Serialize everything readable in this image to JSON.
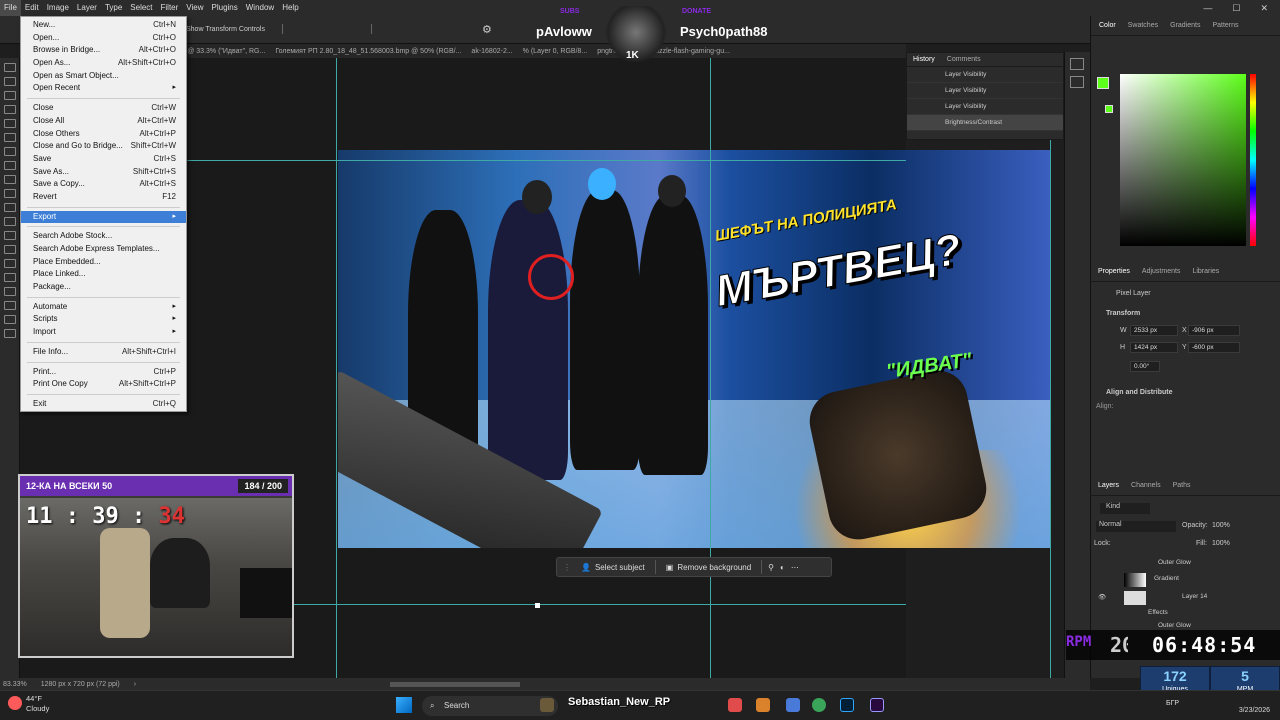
{
  "menubar": {
    "items": [
      "File",
      "Edit",
      "Image",
      "Layer",
      "Type",
      "Select",
      "Filter",
      "View",
      "Plugins",
      "Window",
      "Help"
    ],
    "active": "File"
  },
  "optbar": {
    "show_transform": "Show Transform Controls"
  },
  "tabs": [
    "легенда .psb @ 33.3% (\"Идват\", RG...",
    "Големият РП 2.80_18_48_51.568003.bmp @ 50% (RGB/...",
    "ak-16802-2...",
    "% (Layer 0, RGB/8...",
    "pngtree-realistic-muzzle-flash-gaming-gu..."
  ],
  "file_menu": {
    "groups": [
      [
        {
          "label": "New...",
          "shortcut": "Ctrl+N"
        },
        {
          "label": "Open...",
          "shortcut": "Ctrl+O"
        },
        {
          "label": "Browse in Bridge...",
          "shortcut": "Alt+Ctrl+O"
        },
        {
          "label": "Open As...",
          "shortcut": "Alt+Shift+Ctrl+O"
        },
        {
          "label": "Open as Smart Object...",
          "shortcut": ""
        },
        {
          "label": "Open Recent",
          "shortcut": "",
          "submenu": true
        }
      ],
      [
        {
          "label": "Close",
          "shortcut": "Ctrl+W"
        },
        {
          "label": "Close All",
          "shortcut": "Alt+Ctrl+W"
        },
        {
          "label": "Close Others",
          "shortcut": "Alt+Ctrl+P"
        },
        {
          "label": "Close and Go to Bridge...",
          "shortcut": "Shift+Ctrl+W"
        },
        {
          "label": "Save",
          "shortcut": "Ctrl+S"
        },
        {
          "label": "Save As...",
          "shortcut": "Shift+Ctrl+S"
        },
        {
          "label": "Save a Copy...",
          "shortcut": "Alt+Ctrl+S"
        },
        {
          "label": "Revert",
          "shortcut": "F12"
        }
      ],
      [
        {
          "label": "Export",
          "shortcut": "",
          "submenu": true,
          "highlighted": true
        }
      ],
      [
        {
          "label": "Search Adobe Stock...",
          "shortcut": ""
        },
        {
          "label": "Search Adobe Express Templates...",
          "shortcut": ""
        },
        {
          "label": "Place Embedded...",
          "shortcut": ""
        },
        {
          "label": "Place Linked...",
          "shortcut": ""
        },
        {
          "label": "Package...",
          "shortcut": ""
        }
      ],
      [
        {
          "label": "Automate",
          "shortcut": "",
          "submenu": true
        },
        {
          "label": "Scripts",
          "shortcut": "",
          "submenu": true
        },
        {
          "label": "Import",
          "shortcut": "",
          "submenu": true
        }
      ],
      [
        {
          "label": "File Info...",
          "shortcut": "Alt+Shift+Ctrl+I"
        }
      ],
      [
        {
          "label": "Print...",
          "shortcut": "Ctrl+P"
        },
        {
          "label": "Print One Copy",
          "shortcut": "Alt+Shift+Ctrl+P"
        }
      ],
      [
        {
          "label": "Exit",
          "shortcut": "Ctrl+Q"
        }
      ]
    ]
  },
  "artwork": {
    "headline_small": "ШЕФЪТ НА ПОЛИЦИЯТА",
    "headline_big": "МЪРТВЕЦ?",
    "tag": "\"ИДВАТ\""
  },
  "context_bar": {
    "select_subject": "Select subject",
    "remove_background": "Remove background"
  },
  "statusbar": {
    "zoom": "83.33%",
    "doc_size": "1280 px x 720 px (72 ppi)"
  },
  "history_panel": {
    "tabs": [
      "History",
      "Comments"
    ],
    "items": [
      "Layer Visibility",
      "Layer Visibility",
      "Layer Visibility",
      "Brightness/Contrast"
    ]
  },
  "color_panel": {
    "tabs": [
      "Color",
      "Swatches",
      "Gradients",
      "Patterns"
    ],
    "foreground": "#5dff1a"
  },
  "properties_panel": {
    "tabs": [
      "Properties",
      "Adjustments",
      "Libraries"
    ],
    "kind": "Pixel Layer",
    "transform_label": "Transform",
    "w_label": "W",
    "w": "2533 px",
    "h_label": "H",
    "h": "1424 px",
    "x_label": "X",
    "x": "-906 px",
    "y_label": "Y",
    "y": "-600 px",
    "angle": "0.00°",
    "align_label": "Align and Distribute",
    "align_sub": "Align:"
  },
  "layers_panel": {
    "tabs": [
      "Layers",
      "Channels",
      "Paths"
    ],
    "kind_filter": "Kind",
    "blend_mode": "Normal",
    "opacity_label": "Opacity:",
    "opacity": "100%",
    "lock_label": "Lock:",
    "fill_label": "Fill:",
    "fill": "100%",
    "rows": [
      "Outer Glow",
      "Gradient",
      "Layer 14",
      "Effects",
      "Outer Glow"
    ]
  },
  "overlay": {
    "label_left": "SUBS",
    "label_right": "DONATE",
    "name_left": "pAvloww",
    "name_right": "Psych0path88",
    "badge": "1K"
  },
  "webcam": {
    "goal_title": "12-КА НА ВСЕКИ 50",
    "goal_count": "184 / 200",
    "clock_hm": "11 : 39 :",
    "clock_s": "34"
  },
  "rpm_widget": {
    "label": "RPM",
    "prefix": "20",
    "time": "06:48:54"
  },
  "stats_widget": {
    "uniques_value": "172",
    "uniques_label": "Uniques",
    "mpm_value": "5",
    "mpm_label": "MPM"
  },
  "taskbar": {
    "temp": "44°F",
    "weather": "Cloudy",
    "search": "Search",
    "streamer_name": "Sebastian_New_RP",
    "lang": "БГР",
    "date": "3/23/2026"
  }
}
